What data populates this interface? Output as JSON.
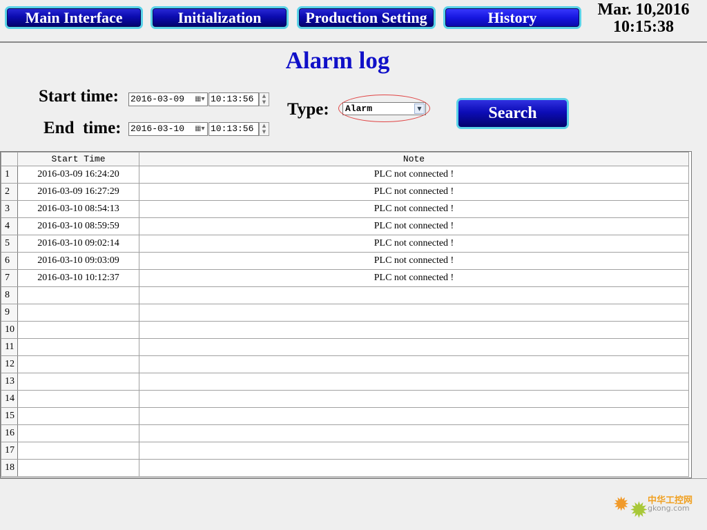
{
  "nav": {
    "main_interface": "Main Interface",
    "initialization": "Initialization",
    "production_setting": "Production Setting",
    "history": "History"
  },
  "datetime": {
    "date": "Mar. 10,2016",
    "time": "10:15:38"
  },
  "page_title": "Alarm log",
  "filters": {
    "start_label": "Start time:",
    "end_label": "End  time:",
    "start_date": "2016-03-09",
    "start_time": "10:13:56",
    "end_date": "2016-03-10",
    "end_time": "10:13:56",
    "type_label": "Type:",
    "type_value": "Alarm",
    "search_label": "Search"
  },
  "table": {
    "columns": [
      "Start Time",
      "Note"
    ],
    "rows": [
      {
        "index": "1",
        "time": "2016-03-09 16:24:20",
        "note": "PLC not connected !"
      },
      {
        "index": "2",
        "time": "2016-03-09 16:27:29",
        "note": "PLC not connected !"
      },
      {
        "index": "3",
        "time": "2016-03-10 08:54:13",
        "note": "PLC not connected !"
      },
      {
        "index": "4",
        "time": "2016-03-10 08:59:59",
        "note": "PLC not connected !"
      },
      {
        "index": "5",
        "time": "2016-03-10 09:02:14",
        "note": "PLC not connected !"
      },
      {
        "index": "6",
        "time": "2016-03-10 09:03:09",
        "note": "PLC not connected !"
      },
      {
        "index": "7",
        "time": "2016-03-10 10:12:37",
        "note": "PLC not connected !"
      },
      {
        "index": "8",
        "time": "",
        "note": ""
      },
      {
        "index": "9",
        "time": "",
        "note": ""
      },
      {
        "index": "10",
        "time": "",
        "note": ""
      },
      {
        "index": "11",
        "time": "",
        "note": ""
      },
      {
        "index": "12",
        "time": "",
        "note": ""
      },
      {
        "index": "13",
        "time": "",
        "note": ""
      },
      {
        "index": "14",
        "time": "",
        "note": ""
      },
      {
        "index": "15",
        "time": "",
        "note": ""
      },
      {
        "index": "16",
        "time": "",
        "note": ""
      },
      {
        "index": "17",
        "time": "",
        "note": ""
      },
      {
        "index": "18",
        "time": "",
        "note": ""
      }
    ]
  },
  "watermark": {
    "text": "中华工控网",
    "url": "gkong.com"
  },
  "colors": {
    "button_blue": "#0b0bb0",
    "button_border": "#5ad2e8",
    "title_blue": "#1010c8"
  },
  "icons": {
    "calendar": "calendar-icon",
    "dropdown": "chevron-down-icon",
    "spinner": "spinner-icon",
    "gear": "gear-icon"
  }
}
